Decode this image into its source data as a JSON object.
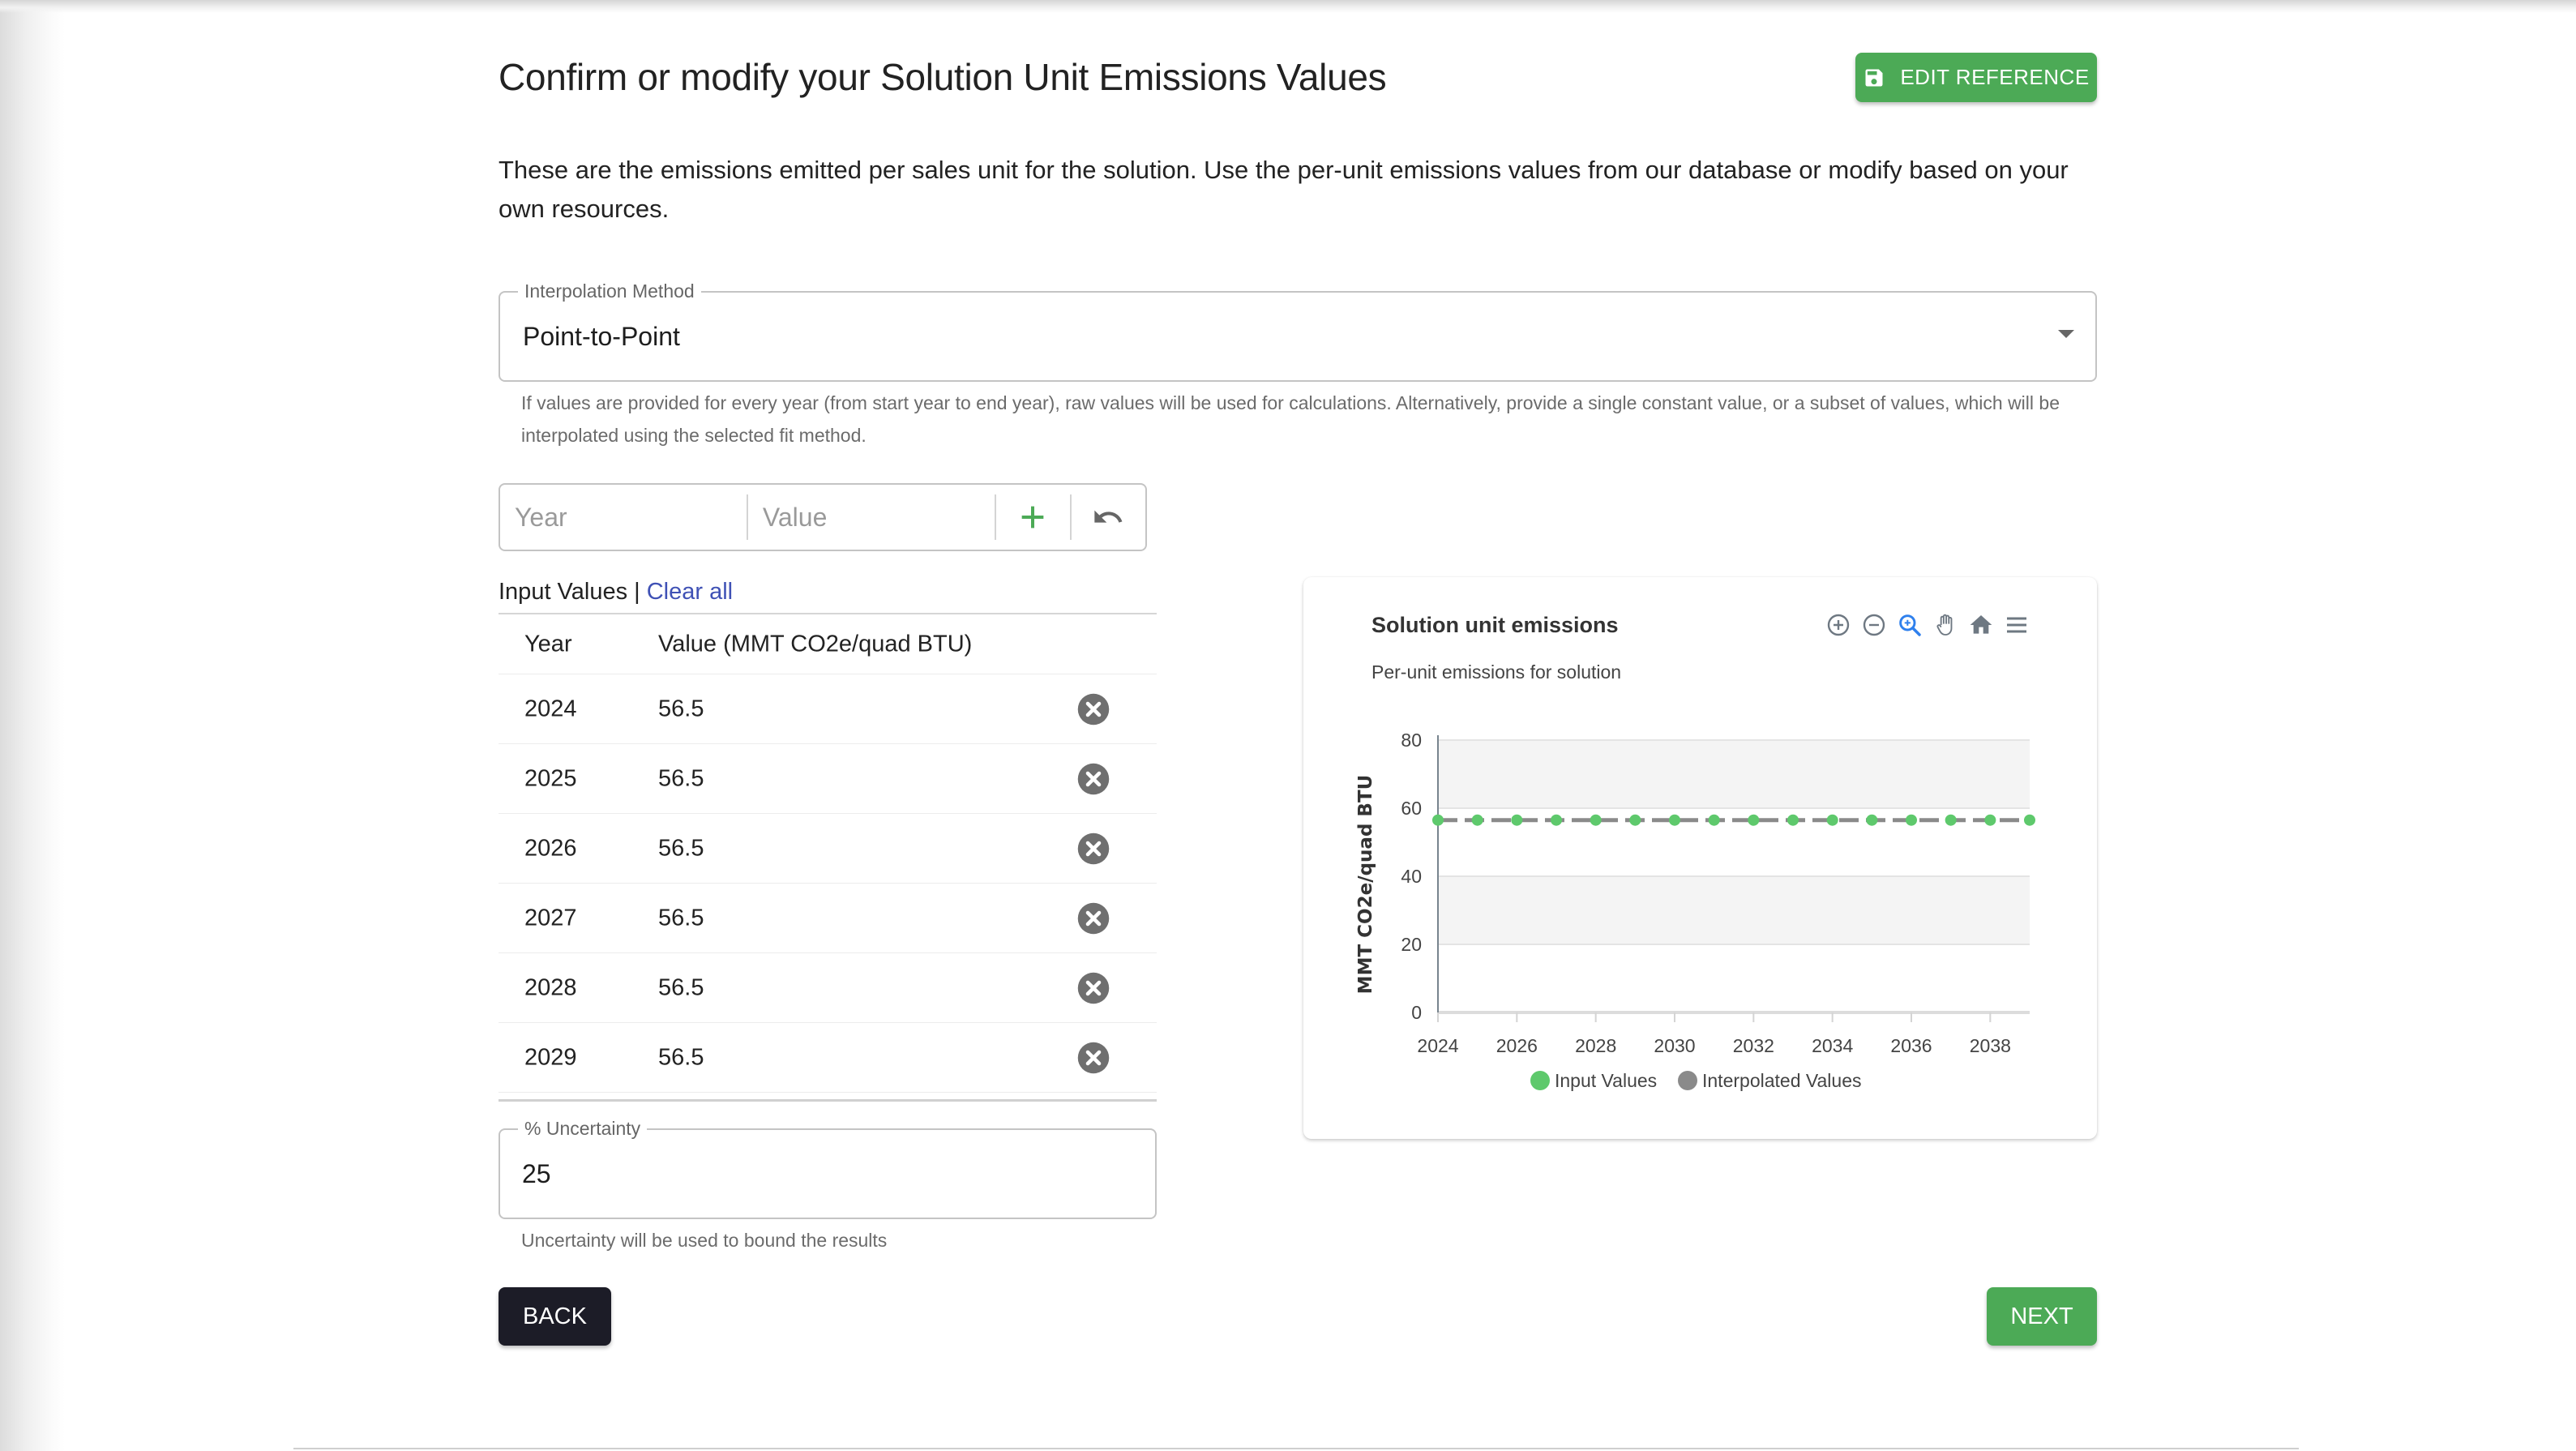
{
  "page": {
    "title": "Confirm or modify your Solution Unit Emissions Values",
    "description": "These are the emissions emitted per sales unit for the solution. Use the per-unit emissions values from our database or modify based on your own resources.",
    "edit_reference_label": "EDIT REFERENCE",
    "edit_reference_icon": "save-icon"
  },
  "colors": {
    "primary_green": "#4caa56",
    "back_button": "#1c1c27",
    "link_blue": "#3f51b5",
    "input_points": "#5ec96c",
    "interpolated_line": "#8a8a8a"
  },
  "interpolation": {
    "label": "Interpolation Method",
    "selected": "Point-to-Point",
    "helper": "If values are provided for every year (from start year to end year), raw values will be used for calculations. Alternatively, provide a single constant value, or a subset of values, which will be interpolated using the selected fit method."
  },
  "entry": {
    "year_placeholder": "Year",
    "value_placeholder": "Value",
    "add_icon": "plus-icon",
    "undo_icon": "undo-icon"
  },
  "input_values": {
    "heading": "Input Values",
    "separator": " | ",
    "clear_all": "Clear all",
    "columns": [
      "Year",
      "Value (MMT CO2e/quad BTU)"
    ],
    "rows": [
      {
        "year": "2024",
        "value": "56.5"
      },
      {
        "year": "2025",
        "value": "56.5"
      },
      {
        "year": "2026",
        "value": "56.5"
      },
      {
        "year": "2027",
        "value": "56.5"
      },
      {
        "year": "2028",
        "value": "56.5"
      },
      {
        "year": "2029",
        "value": "56.5"
      }
    ]
  },
  "uncertainty": {
    "label": "% Uncertainty",
    "value": "25",
    "helper": "Uncertainty will be used to bound the results"
  },
  "nav": {
    "back_label": "BACK",
    "next_label": "NEXT"
  },
  "chart_toolbar": [
    "zoom-in-icon",
    "zoom-out-icon",
    "selection-zoom-icon",
    "pan-hand-icon",
    "reset-home-icon",
    "menu-icon"
  ],
  "chart_data": {
    "type": "line",
    "title": "Solution unit emissions",
    "subtitle": "Per-unit emissions for solution",
    "xlabel": "",
    "ylabel": "MMT CO2e/quad BTU",
    "xlim": [
      2024,
      2039
    ],
    "ylim": [
      0,
      80
    ],
    "x_ticks": [
      "2024",
      "2026",
      "2028",
      "2030",
      "2032",
      "2034",
      "2036",
      "2038"
    ],
    "y_ticks": [
      "0",
      "20",
      "40",
      "60",
      "80"
    ],
    "grid": "horizontal, alternating bands",
    "legend": [
      "Input Values",
      "Interpolated Values"
    ],
    "legend_position": "bottom-center",
    "series": [
      {
        "name": "Interpolated Values",
        "style": "dashed-line",
        "x": [
          2024,
          2025,
          2026,
          2027,
          2028,
          2029,
          2030,
          2031,
          2032,
          2033,
          2034,
          2035,
          2036,
          2037,
          2038,
          2039
        ],
        "values": [
          56.5,
          56.5,
          56.5,
          56.5,
          56.5,
          56.5,
          56.5,
          56.5,
          56.5,
          56.5,
          56.5,
          56.5,
          56.5,
          56.5,
          56.5,
          56.5
        ]
      },
      {
        "name": "Input Values",
        "style": "markers",
        "x": [
          2024,
          2025,
          2026,
          2027,
          2028,
          2029,
          2030,
          2031,
          2032,
          2033,
          2034,
          2035,
          2036,
          2037,
          2038,
          2039
        ],
        "values": [
          56.5,
          56.5,
          56.5,
          56.5,
          56.5,
          56.5,
          56.5,
          56.5,
          56.5,
          56.5,
          56.5,
          56.5,
          56.5,
          56.5,
          56.5,
          56.5
        ]
      }
    ]
  }
}
